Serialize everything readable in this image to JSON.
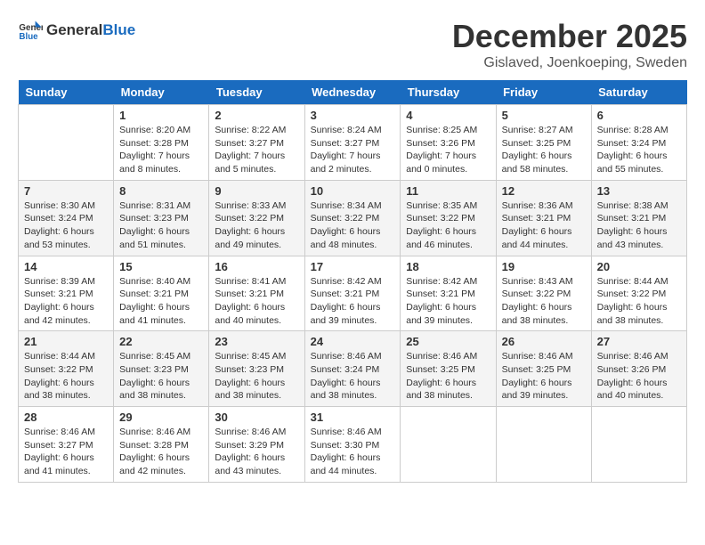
{
  "logo": {
    "text_general": "General",
    "text_blue": "Blue"
  },
  "title": {
    "month": "December 2025",
    "location": "Gislaved, Joenkoeping, Sweden"
  },
  "columns": [
    "Sunday",
    "Monday",
    "Tuesday",
    "Wednesday",
    "Thursday",
    "Friday",
    "Saturday"
  ],
  "weeks": [
    [
      {
        "day": "",
        "info": ""
      },
      {
        "day": "1",
        "info": "Sunrise: 8:20 AM\nSunset: 3:28 PM\nDaylight: 7 hours\nand 8 minutes."
      },
      {
        "day": "2",
        "info": "Sunrise: 8:22 AM\nSunset: 3:27 PM\nDaylight: 7 hours\nand 5 minutes."
      },
      {
        "day": "3",
        "info": "Sunrise: 8:24 AM\nSunset: 3:27 PM\nDaylight: 7 hours\nand 2 minutes."
      },
      {
        "day": "4",
        "info": "Sunrise: 8:25 AM\nSunset: 3:26 PM\nDaylight: 7 hours\nand 0 minutes."
      },
      {
        "day": "5",
        "info": "Sunrise: 8:27 AM\nSunset: 3:25 PM\nDaylight: 6 hours\nand 58 minutes."
      },
      {
        "day": "6",
        "info": "Sunrise: 8:28 AM\nSunset: 3:24 PM\nDaylight: 6 hours\nand 55 minutes."
      }
    ],
    [
      {
        "day": "7",
        "info": "Sunrise: 8:30 AM\nSunset: 3:24 PM\nDaylight: 6 hours\nand 53 minutes."
      },
      {
        "day": "8",
        "info": "Sunrise: 8:31 AM\nSunset: 3:23 PM\nDaylight: 6 hours\nand 51 minutes."
      },
      {
        "day": "9",
        "info": "Sunrise: 8:33 AM\nSunset: 3:22 PM\nDaylight: 6 hours\nand 49 minutes."
      },
      {
        "day": "10",
        "info": "Sunrise: 8:34 AM\nSunset: 3:22 PM\nDaylight: 6 hours\nand 48 minutes."
      },
      {
        "day": "11",
        "info": "Sunrise: 8:35 AM\nSunset: 3:22 PM\nDaylight: 6 hours\nand 46 minutes."
      },
      {
        "day": "12",
        "info": "Sunrise: 8:36 AM\nSunset: 3:21 PM\nDaylight: 6 hours\nand 44 minutes."
      },
      {
        "day": "13",
        "info": "Sunrise: 8:38 AM\nSunset: 3:21 PM\nDaylight: 6 hours\nand 43 minutes."
      }
    ],
    [
      {
        "day": "14",
        "info": "Sunrise: 8:39 AM\nSunset: 3:21 PM\nDaylight: 6 hours\nand 42 minutes."
      },
      {
        "day": "15",
        "info": "Sunrise: 8:40 AM\nSunset: 3:21 PM\nDaylight: 6 hours\nand 41 minutes."
      },
      {
        "day": "16",
        "info": "Sunrise: 8:41 AM\nSunset: 3:21 PM\nDaylight: 6 hours\nand 40 minutes."
      },
      {
        "day": "17",
        "info": "Sunrise: 8:42 AM\nSunset: 3:21 PM\nDaylight: 6 hours\nand 39 minutes."
      },
      {
        "day": "18",
        "info": "Sunrise: 8:42 AM\nSunset: 3:21 PM\nDaylight: 6 hours\nand 39 minutes."
      },
      {
        "day": "19",
        "info": "Sunrise: 8:43 AM\nSunset: 3:22 PM\nDaylight: 6 hours\nand 38 minutes."
      },
      {
        "day": "20",
        "info": "Sunrise: 8:44 AM\nSunset: 3:22 PM\nDaylight: 6 hours\nand 38 minutes."
      }
    ],
    [
      {
        "day": "21",
        "info": "Sunrise: 8:44 AM\nSunset: 3:22 PM\nDaylight: 6 hours\nand 38 minutes."
      },
      {
        "day": "22",
        "info": "Sunrise: 8:45 AM\nSunset: 3:23 PM\nDaylight: 6 hours\nand 38 minutes."
      },
      {
        "day": "23",
        "info": "Sunrise: 8:45 AM\nSunset: 3:23 PM\nDaylight: 6 hours\nand 38 minutes."
      },
      {
        "day": "24",
        "info": "Sunrise: 8:46 AM\nSunset: 3:24 PM\nDaylight: 6 hours\nand 38 minutes."
      },
      {
        "day": "25",
        "info": "Sunrise: 8:46 AM\nSunset: 3:25 PM\nDaylight: 6 hours\nand 38 minutes."
      },
      {
        "day": "26",
        "info": "Sunrise: 8:46 AM\nSunset: 3:25 PM\nDaylight: 6 hours\nand 39 minutes."
      },
      {
        "day": "27",
        "info": "Sunrise: 8:46 AM\nSunset: 3:26 PM\nDaylight: 6 hours\nand 40 minutes."
      }
    ],
    [
      {
        "day": "28",
        "info": "Sunrise: 8:46 AM\nSunset: 3:27 PM\nDaylight: 6 hours\nand 41 minutes."
      },
      {
        "day": "29",
        "info": "Sunrise: 8:46 AM\nSunset: 3:28 PM\nDaylight: 6 hours\nand 42 minutes."
      },
      {
        "day": "30",
        "info": "Sunrise: 8:46 AM\nSunset: 3:29 PM\nDaylight: 6 hours\nand 43 minutes."
      },
      {
        "day": "31",
        "info": "Sunrise: 8:46 AM\nSunset: 3:30 PM\nDaylight: 6 hours\nand 44 minutes."
      },
      {
        "day": "",
        "info": ""
      },
      {
        "day": "",
        "info": ""
      },
      {
        "day": "",
        "info": ""
      }
    ]
  ]
}
